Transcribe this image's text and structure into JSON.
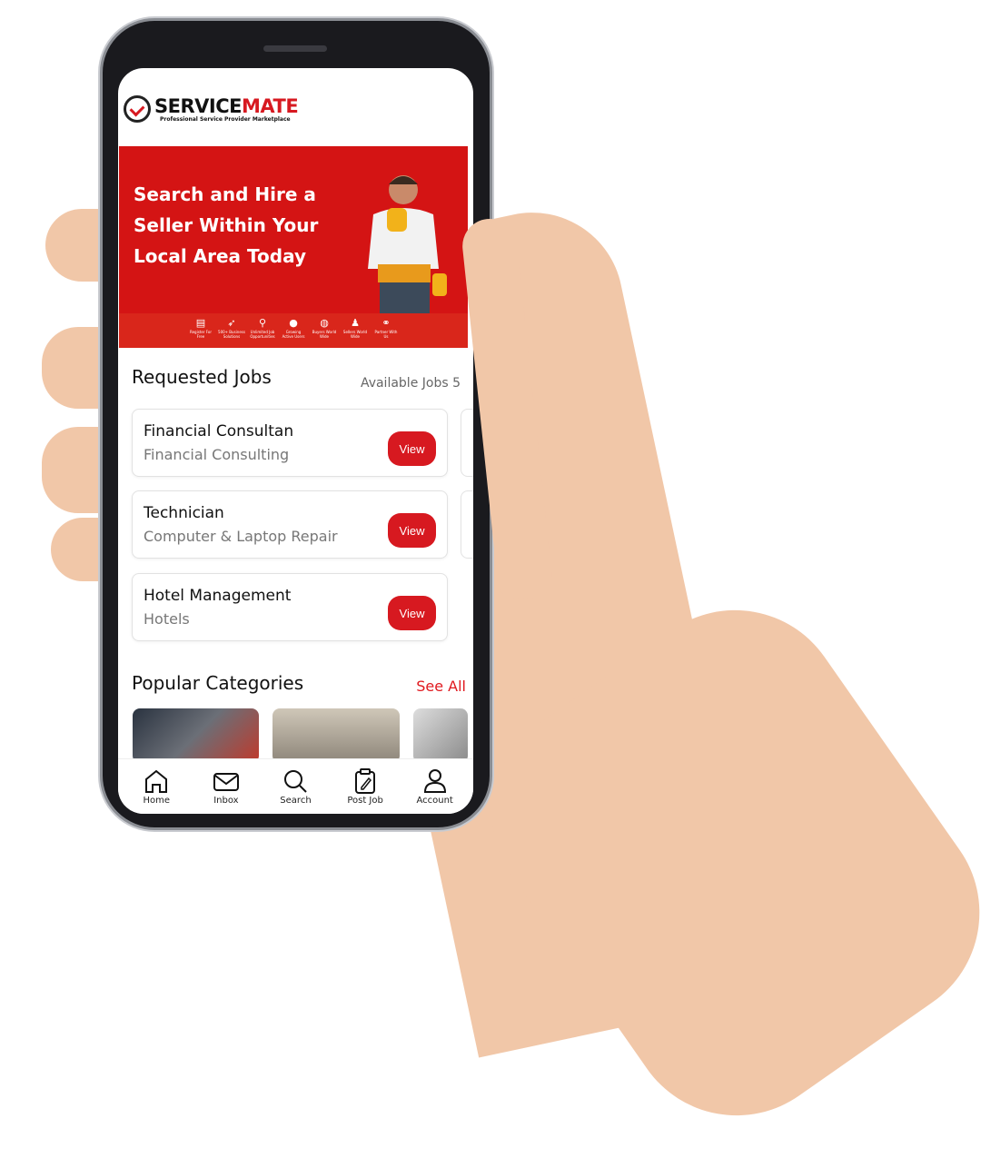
{
  "app": {
    "brand_main": "SERVICE",
    "brand_accent": "MATE",
    "tagline": "Professional Service Provider Marketplace",
    "accent_color": "#d71920"
  },
  "banner": {
    "headline": "Search and Hire a Seller Within Your Local Area Today",
    "features": [
      {
        "icon": "register-icon",
        "label": "Register For Free"
      },
      {
        "icon": "rocket-icon",
        "label": "500+ Business Solutions"
      },
      {
        "icon": "search-person-icon",
        "label": "Unlimited Job Opportunities"
      },
      {
        "icon": "users-icon",
        "label": "Growing Active Users"
      },
      {
        "icon": "globe-icon",
        "label": "Buyers World Wide"
      },
      {
        "icon": "seller-icon",
        "label": "Sellers World Wide"
      },
      {
        "icon": "handshake-icon",
        "label": "Partner With Us"
      }
    ]
  },
  "requested_jobs": {
    "title": "Requested Jobs",
    "available": "Available Jobs 5",
    "jobs": [
      {
        "title": "Financial Consultan",
        "category": "Financial Consulting",
        "action": "View"
      },
      {
        "title": "Technician",
        "category": "Computer & Laptop Repair",
        "action": "View"
      },
      {
        "title": "Hotel Management",
        "category": "Hotels",
        "action": "View"
      }
    ]
  },
  "categories": {
    "title": "Popular Categories",
    "see_all": "See All"
  },
  "nav": [
    {
      "icon": "home-icon",
      "label": "Home"
    },
    {
      "icon": "mail-icon",
      "label": "Inbox"
    },
    {
      "icon": "search-icon",
      "label": "Search"
    },
    {
      "icon": "clipboard-icon",
      "label": "Post Job"
    },
    {
      "icon": "user-icon",
      "label": "Account"
    }
  ]
}
